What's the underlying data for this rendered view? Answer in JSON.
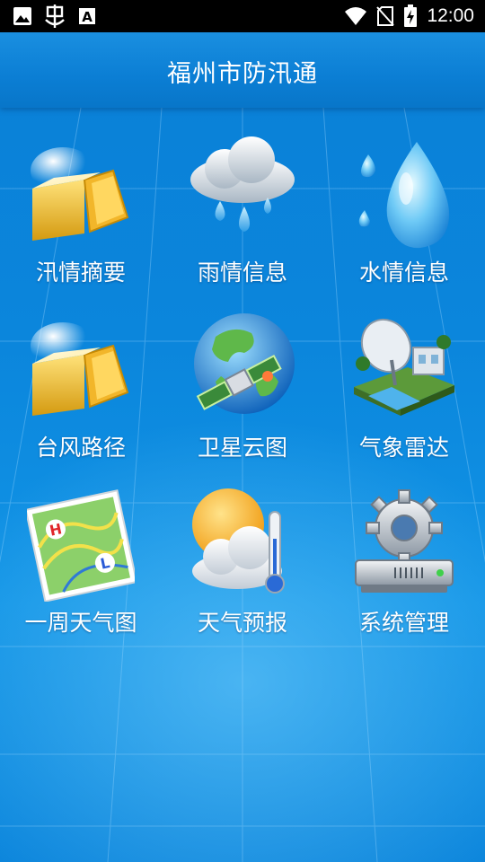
{
  "status_bar": {
    "time": "12:00",
    "left_icons": [
      "image-icon",
      "bug-icon",
      "font-a-icon"
    ],
    "right_icons": [
      "wifi-icon",
      "no-sim-icon",
      "battery-charging-icon"
    ]
  },
  "header": {
    "title": "福州市防汛通"
  },
  "menu": {
    "items": [
      {
        "label": "汛情摘要",
        "icon": "folder-box-icon"
      },
      {
        "label": "雨情信息",
        "icon": "rain-cloud-icon"
      },
      {
        "label": "水情信息",
        "icon": "water-drop-icon"
      },
      {
        "label": "台风路径",
        "icon": "folder-box-icon"
      },
      {
        "label": "卫星云图",
        "icon": "satellite-globe-icon"
      },
      {
        "label": "气象雷达",
        "icon": "radar-station-icon"
      },
      {
        "label": "一周天气图",
        "icon": "weather-map-icon"
      },
      {
        "label": "天气预报",
        "icon": "weather-forecast-icon"
      },
      {
        "label": "系统管理",
        "icon": "gear-drive-icon"
      }
    ]
  },
  "colors": {
    "background": "#0b86dc",
    "title_bar": "#0b7ed4",
    "status_bar": "#000000",
    "text": "#ffffff"
  }
}
